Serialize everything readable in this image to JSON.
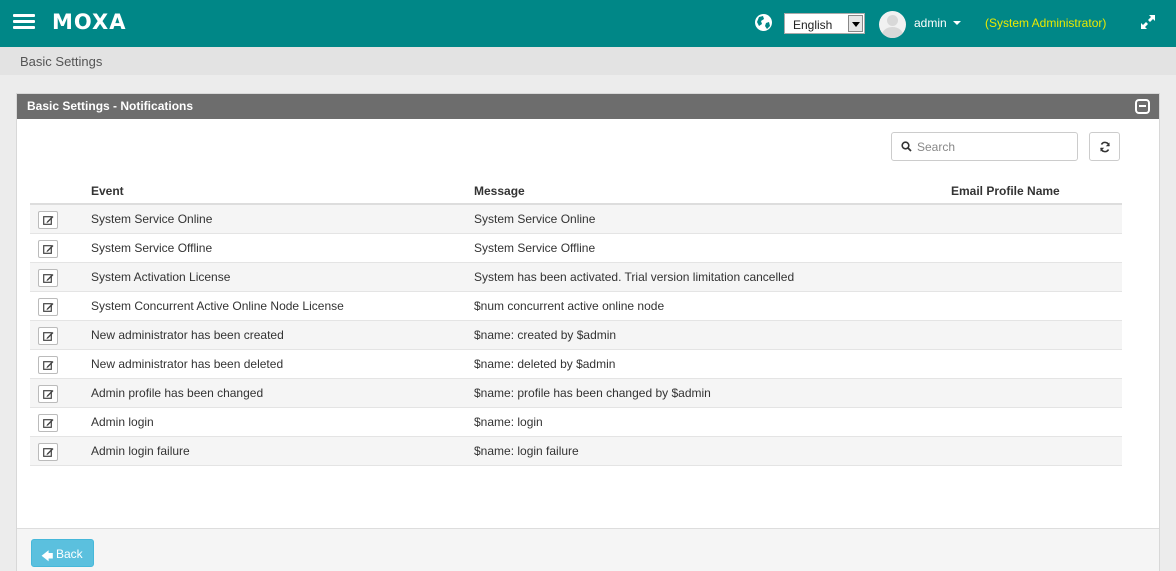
{
  "header": {
    "logo": "MOXA",
    "language": "English",
    "user": "admin",
    "role": "(System Administrator)"
  },
  "breadcrumb": "Basic Settings",
  "panel": {
    "title": "Basic Settings - Notifications",
    "search_placeholder": "Search"
  },
  "table": {
    "columns": [
      "Event",
      "Message",
      "Email Profile Name"
    ],
    "rows": [
      {
        "event": "System Service Online",
        "message": "System Service Online",
        "email": ""
      },
      {
        "event": "System Service Offline",
        "message": "System Service Offline",
        "email": ""
      },
      {
        "event": "System Activation License",
        "message": "System has been activated. Trial version limitation cancelled",
        "email": ""
      },
      {
        "event": "System Concurrent Active Online Node License",
        "message": "$num concurrent active online node",
        "email": ""
      },
      {
        "event": "New administrator has been created",
        "message": "$name: created by $admin",
        "email": ""
      },
      {
        "event": "New administrator has been deleted",
        "message": "$name: deleted by $admin",
        "email": ""
      },
      {
        "event": "Admin profile has been changed",
        "message": "$name: profile has been changed by $admin",
        "email": ""
      },
      {
        "event": "Admin login",
        "message": "$name: login",
        "email": ""
      },
      {
        "event": "Admin login failure",
        "message": "$name: login failure",
        "email": ""
      }
    ]
  },
  "footer": {
    "back_label": "Back"
  },
  "colors": {
    "navbar": "#008787",
    "role_text": "#eaea00",
    "panel_header": "#6d6d6d",
    "back_button": "#5bc0de"
  },
  "icons": [
    "menu-icon",
    "globe-icon",
    "user-avatar",
    "caret-down-icon",
    "expand-icon",
    "collapse-icon",
    "search-icon",
    "refresh-icon",
    "edit-icon",
    "arrow-left-icon"
  ]
}
